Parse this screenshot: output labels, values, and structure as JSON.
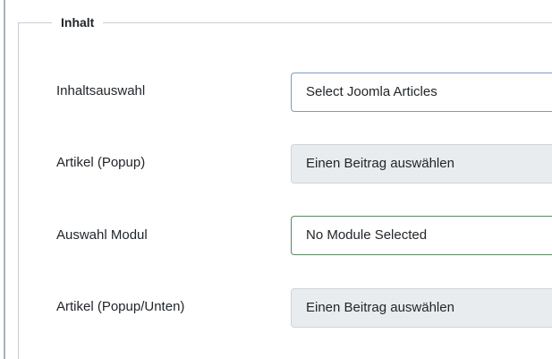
{
  "fieldset": {
    "legend": "Inhalt"
  },
  "rows": [
    {
      "label": "Inhaltsauswahl",
      "value": "Select Joomla Articles"
    },
    {
      "label": "Artikel (Popup)",
      "value": "Einen Beitrag auswählen"
    },
    {
      "label": "Auswahl Modul",
      "value": "No Module Selected"
    },
    {
      "label": "Artikel (Popup/Unten)",
      "value": "Einen Beitrag auswählen"
    }
  ]
}
